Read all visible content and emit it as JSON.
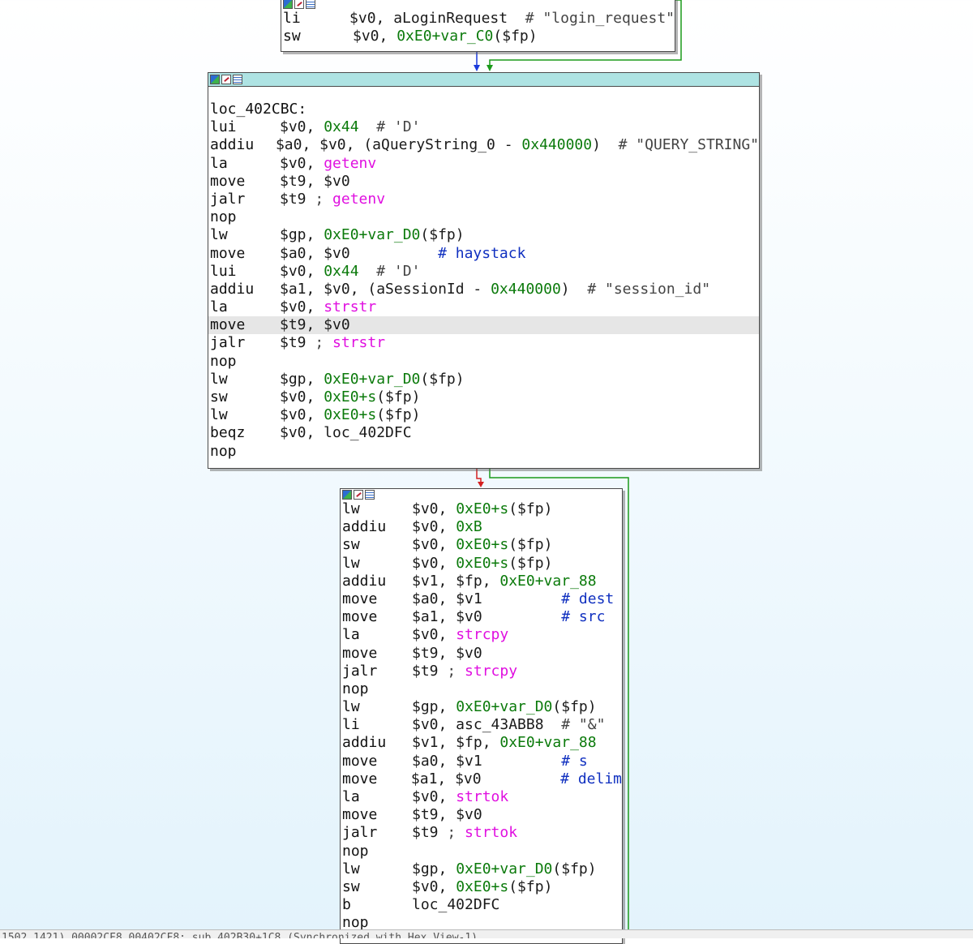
{
  "window": {
    "status_bar": "1502 1421) 00002CF8 00402CF8: sub_402B30+1C8 (Synchronized with Hex View-1)"
  },
  "colors": {
    "edge_true": "#1a9a1a",
    "edge_false": "#d42020",
    "edge_normal": "#1a3adc",
    "header": "#aee3e3",
    "highlight": "#e6e6e6"
  },
  "blocks": [
    {
      "id": "top-block",
      "label": "",
      "lines": [
        {
          "m": "li",
          "ops": [
            {
              "t": "$v0, aLoginRequest  ",
              "c": "reg"
            },
            {
              "t": "# \"login_request\"",
              "c": "cmt"
            }
          ]
        },
        {
          "m": "sw",
          "ops": [
            {
              "t": "$v0, ",
              "c": "reg"
            },
            {
              "t": "0xE0+var_C0",
              "c": "num"
            },
            {
              "t": "($fp)",
              "c": "reg"
            }
          ]
        }
      ]
    },
    {
      "id": "middle-block",
      "label": "loc_402CBC:",
      "lines": [
        {
          "m": "lui",
          "ops": [
            {
              "t": "$v0, ",
              "c": "reg"
            },
            {
              "t": "0x44",
              "c": "num"
            },
            {
              "t": "  # 'D'",
              "c": "cmt"
            }
          ]
        },
        {
          "m": "addiu",
          "ops": [
            {
              "t": "$a0, $v0, (aQueryString_0 - ",
              "c": "reg"
            },
            {
              "t": "0x440000",
              "c": "num"
            },
            {
              "t": ")  ",
              "c": "reg"
            },
            {
              "t": "# \"QUERY_STRING\"",
              "c": "cmt"
            }
          ]
        },
        {
          "m": "la",
          "ops": [
            {
              "t": "$v0, ",
              "c": "reg"
            },
            {
              "t": "getenv",
              "c": "fn"
            }
          ]
        },
        {
          "m": "move",
          "ops": [
            {
              "t": "$t9, $v0",
              "c": "reg"
            }
          ]
        },
        {
          "m": "jalr",
          "ops": [
            {
              "t": "$t9 ",
              "c": "reg"
            },
            {
              "t": "; ",
              "c": "cmt"
            },
            {
              "t": "getenv",
              "c": "fn"
            }
          ]
        },
        {
          "m": "nop",
          "ops": []
        },
        {
          "m": "lw",
          "ops": [
            {
              "t": "$gp, ",
              "c": "reg"
            },
            {
              "t": "0xE0+var_D0",
              "c": "num"
            },
            {
              "t": "($fp)",
              "c": "reg"
            }
          ]
        },
        {
          "m": "move",
          "ops": [
            {
              "t": "$a0, $v0          ",
              "c": "reg"
            },
            {
              "t": "# haystack",
              "c": "hash"
            }
          ]
        },
        {
          "m": "lui",
          "ops": [
            {
              "t": "$v0, ",
              "c": "reg"
            },
            {
              "t": "0x44",
              "c": "num"
            },
            {
              "t": "  # 'D'",
              "c": "cmt"
            }
          ]
        },
        {
          "m": "addiu",
          "ops": [
            {
              "t": "$a1, $v0, (aSessionId - ",
              "c": "reg"
            },
            {
              "t": "0x440000",
              "c": "num"
            },
            {
              "t": ")  ",
              "c": "reg"
            },
            {
              "t": "# \"session_id\"",
              "c": "cmt"
            }
          ]
        },
        {
          "m": "la",
          "ops": [
            {
              "t": "$v0, ",
              "c": "reg"
            },
            {
              "t": "strstr",
              "c": "fn"
            }
          ]
        },
        {
          "m": "move",
          "ops": [
            {
              "t": "$t9, $v0",
              "c": "reg"
            }
          ],
          "highlight": true
        },
        {
          "m": "jalr",
          "ops": [
            {
              "t": "$t9 ",
              "c": "reg"
            },
            {
              "t": "; ",
              "c": "cmt"
            },
            {
              "t": "strstr",
              "c": "fn"
            }
          ]
        },
        {
          "m": "nop",
          "ops": []
        },
        {
          "m": "lw",
          "ops": [
            {
              "t": "$gp, ",
              "c": "reg"
            },
            {
              "t": "0xE0+var_D0",
              "c": "num"
            },
            {
              "t": "($fp)",
              "c": "reg"
            }
          ]
        },
        {
          "m": "sw",
          "ops": [
            {
              "t": "$v0, ",
              "c": "reg"
            },
            {
              "t": "0xE0+s",
              "c": "num"
            },
            {
              "t": "($fp)",
              "c": "reg"
            }
          ]
        },
        {
          "m": "lw",
          "ops": [
            {
              "t": "$v0, ",
              "c": "reg"
            },
            {
              "t": "0xE0+s",
              "c": "num"
            },
            {
              "t": "($fp)",
              "c": "reg"
            }
          ]
        },
        {
          "m": "beqz",
          "ops": [
            {
              "t": "$v0, loc_402DFC",
              "c": "reg"
            }
          ]
        },
        {
          "m": "nop",
          "ops": []
        }
      ]
    },
    {
      "id": "bottom-block",
      "label": "",
      "lines": [
        {
          "m": "lw",
          "ops": [
            {
              "t": "$v0, ",
              "c": "reg"
            },
            {
              "t": "0xE0+s",
              "c": "num"
            },
            {
              "t": "($fp)",
              "c": "reg"
            }
          ]
        },
        {
          "m": "addiu",
          "ops": [
            {
              "t": "$v0, ",
              "c": "reg"
            },
            {
              "t": "0xB",
              "c": "num"
            }
          ]
        },
        {
          "m": "sw",
          "ops": [
            {
              "t": "$v0, ",
              "c": "reg"
            },
            {
              "t": "0xE0+s",
              "c": "num"
            },
            {
              "t": "($fp)",
              "c": "reg"
            }
          ]
        },
        {
          "m": "lw",
          "ops": [
            {
              "t": "$v0, ",
              "c": "reg"
            },
            {
              "t": "0xE0+s",
              "c": "num"
            },
            {
              "t": "($fp)",
              "c": "reg"
            }
          ]
        },
        {
          "m": "addiu",
          "ops": [
            {
              "t": "$v1, $fp, ",
              "c": "reg"
            },
            {
              "t": "0xE0+var_88",
              "c": "num"
            }
          ]
        },
        {
          "m": "move",
          "ops": [
            {
              "t": "$a0, $v1         ",
              "c": "reg"
            },
            {
              "t": "# dest",
              "c": "hash"
            }
          ]
        },
        {
          "m": "move",
          "ops": [
            {
              "t": "$a1, $v0         ",
              "c": "reg"
            },
            {
              "t": "# src",
              "c": "hash"
            }
          ]
        },
        {
          "m": "la",
          "ops": [
            {
              "t": "$v0, ",
              "c": "reg"
            },
            {
              "t": "strcpy",
              "c": "fn"
            }
          ]
        },
        {
          "m": "move",
          "ops": [
            {
              "t": "$t9, $v0",
              "c": "reg"
            }
          ]
        },
        {
          "m": "jalr",
          "ops": [
            {
              "t": "$t9 ",
              "c": "reg"
            },
            {
              "t": "; ",
              "c": "cmt"
            },
            {
              "t": "strcpy",
              "c": "fn"
            }
          ]
        },
        {
          "m": "nop",
          "ops": []
        },
        {
          "m": "lw",
          "ops": [
            {
              "t": "$gp, ",
              "c": "reg"
            },
            {
              "t": "0xE0+var_D0",
              "c": "num"
            },
            {
              "t": "($fp)",
              "c": "reg"
            }
          ]
        },
        {
          "m": "li",
          "ops": [
            {
              "t": "$v0, asc_43ABB8  ",
              "c": "reg"
            },
            {
              "t": "# \"&\"",
              "c": "cmt"
            }
          ]
        },
        {
          "m": "addiu",
          "ops": [
            {
              "t": "$v1, $fp, ",
              "c": "reg"
            },
            {
              "t": "0xE0+var_88",
              "c": "num"
            }
          ]
        },
        {
          "m": "move",
          "ops": [
            {
              "t": "$a0, $v1         ",
              "c": "reg"
            },
            {
              "t": "# s",
              "c": "hash"
            }
          ]
        },
        {
          "m": "move",
          "ops": [
            {
              "t": "$a1, $v0         ",
              "c": "reg"
            },
            {
              "t": "# delim",
              "c": "hash"
            }
          ]
        },
        {
          "m": "la",
          "ops": [
            {
              "t": "$v0, ",
              "c": "reg"
            },
            {
              "t": "strtok",
              "c": "fn"
            }
          ]
        },
        {
          "m": "move",
          "ops": [
            {
              "t": "$t9, $v0",
              "c": "reg"
            }
          ]
        },
        {
          "m": "jalr",
          "ops": [
            {
              "t": "$t9 ",
              "c": "reg"
            },
            {
              "t": "; ",
              "c": "cmt"
            },
            {
              "t": "strtok",
              "c": "fn"
            }
          ]
        },
        {
          "m": "nop",
          "ops": []
        },
        {
          "m": "lw",
          "ops": [
            {
              "t": "$gp, ",
              "c": "reg"
            },
            {
              "t": "0xE0+var_D0",
              "c": "num"
            },
            {
              "t": "($fp)",
              "c": "reg"
            }
          ]
        },
        {
          "m": "sw",
          "ops": [
            {
              "t": "$v0, ",
              "c": "reg"
            },
            {
              "t": "0xE0+s",
              "c": "num"
            },
            {
              "t": "($fp)",
              "c": "reg"
            }
          ]
        },
        {
          "m": "b",
          "ops": [
            {
              "t": "loc_402DFC",
              "c": "reg"
            }
          ]
        },
        {
          "m": "nop",
          "ops": []
        }
      ]
    }
  ]
}
